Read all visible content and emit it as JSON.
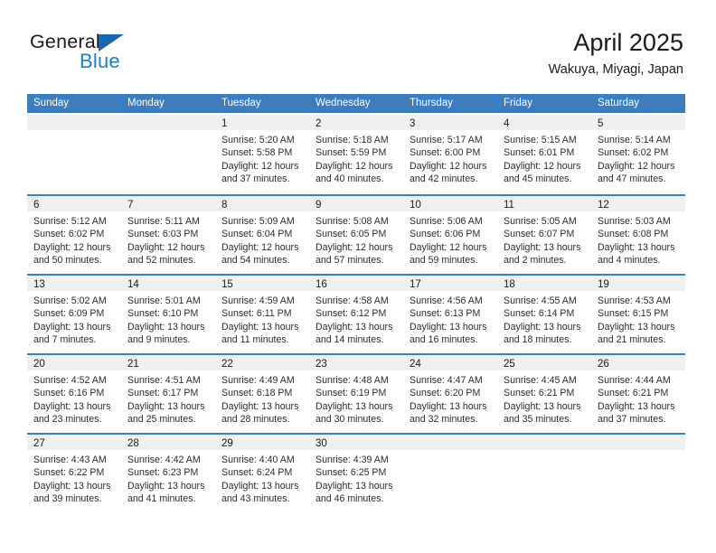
{
  "brand": {
    "name_top": "General",
    "name_bottom": "Blue",
    "triangle_icon": "brand-triangle-icon",
    "color_dark": "#1a1a1a",
    "color_blue": "#1f7fc4"
  },
  "header": {
    "title": "April 2025",
    "subtitle": "Wakuya, Miyagi, Japan"
  },
  "colors": {
    "header_blue": "#3d7cbd",
    "day_strip_gray": "#f0f0f0",
    "text": "#1a1a1a"
  },
  "weekdays": [
    "Sunday",
    "Monday",
    "Tuesday",
    "Wednesday",
    "Thursday",
    "Friday",
    "Saturday"
  ],
  "weeks": [
    [
      {
        "day": "",
        "lines": []
      },
      {
        "day": "",
        "lines": []
      },
      {
        "day": "1",
        "lines": [
          "Sunrise: 5:20 AM",
          "Sunset: 5:58 PM",
          "Daylight: 12 hours",
          "and 37 minutes."
        ]
      },
      {
        "day": "2",
        "lines": [
          "Sunrise: 5:18 AM",
          "Sunset: 5:59 PM",
          "Daylight: 12 hours",
          "and 40 minutes."
        ]
      },
      {
        "day": "3",
        "lines": [
          "Sunrise: 5:17 AM",
          "Sunset: 6:00 PM",
          "Daylight: 12 hours",
          "and 42 minutes."
        ]
      },
      {
        "day": "4",
        "lines": [
          "Sunrise: 5:15 AM",
          "Sunset: 6:01 PM",
          "Daylight: 12 hours",
          "and 45 minutes."
        ]
      },
      {
        "day": "5",
        "lines": [
          "Sunrise: 5:14 AM",
          "Sunset: 6:02 PM",
          "Daylight: 12 hours",
          "and 47 minutes."
        ]
      }
    ],
    [
      {
        "day": "6",
        "lines": [
          "Sunrise: 5:12 AM",
          "Sunset: 6:02 PM",
          "Daylight: 12 hours",
          "and 50 minutes."
        ]
      },
      {
        "day": "7",
        "lines": [
          "Sunrise: 5:11 AM",
          "Sunset: 6:03 PM",
          "Daylight: 12 hours",
          "and 52 minutes."
        ]
      },
      {
        "day": "8",
        "lines": [
          "Sunrise: 5:09 AM",
          "Sunset: 6:04 PM",
          "Daylight: 12 hours",
          "and 54 minutes."
        ]
      },
      {
        "day": "9",
        "lines": [
          "Sunrise: 5:08 AM",
          "Sunset: 6:05 PM",
          "Daylight: 12 hours",
          "and 57 minutes."
        ]
      },
      {
        "day": "10",
        "lines": [
          "Sunrise: 5:06 AM",
          "Sunset: 6:06 PM",
          "Daylight: 12 hours",
          "and 59 minutes."
        ]
      },
      {
        "day": "11",
        "lines": [
          "Sunrise: 5:05 AM",
          "Sunset: 6:07 PM",
          "Daylight: 13 hours",
          "and 2 minutes."
        ]
      },
      {
        "day": "12",
        "lines": [
          "Sunrise: 5:03 AM",
          "Sunset: 6:08 PM",
          "Daylight: 13 hours",
          "and 4 minutes."
        ]
      }
    ],
    [
      {
        "day": "13",
        "lines": [
          "Sunrise: 5:02 AM",
          "Sunset: 6:09 PM",
          "Daylight: 13 hours",
          "and 7 minutes."
        ]
      },
      {
        "day": "14",
        "lines": [
          "Sunrise: 5:01 AM",
          "Sunset: 6:10 PM",
          "Daylight: 13 hours",
          "and 9 minutes."
        ]
      },
      {
        "day": "15",
        "lines": [
          "Sunrise: 4:59 AM",
          "Sunset: 6:11 PM",
          "Daylight: 13 hours",
          "and 11 minutes."
        ]
      },
      {
        "day": "16",
        "lines": [
          "Sunrise: 4:58 AM",
          "Sunset: 6:12 PM",
          "Daylight: 13 hours",
          "and 14 minutes."
        ]
      },
      {
        "day": "17",
        "lines": [
          "Sunrise: 4:56 AM",
          "Sunset: 6:13 PM",
          "Daylight: 13 hours",
          "and 16 minutes."
        ]
      },
      {
        "day": "18",
        "lines": [
          "Sunrise: 4:55 AM",
          "Sunset: 6:14 PM",
          "Daylight: 13 hours",
          "and 18 minutes."
        ]
      },
      {
        "day": "19",
        "lines": [
          "Sunrise: 4:53 AM",
          "Sunset: 6:15 PM",
          "Daylight: 13 hours",
          "and 21 minutes."
        ]
      }
    ],
    [
      {
        "day": "20",
        "lines": [
          "Sunrise: 4:52 AM",
          "Sunset: 6:16 PM",
          "Daylight: 13 hours",
          "and 23 minutes."
        ]
      },
      {
        "day": "21",
        "lines": [
          "Sunrise: 4:51 AM",
          "Sunset: 6:17 PM",
          "Daylight: 13 hours",
          "and 25 minutes."
        ]
      },
      {
        "day": "22",
        "lines": [
          "Sunrise: 4:49 AM",
          "Sunset: 6:18 PM",
          "Daylight: 13 hours",
          "and 28 minutes."
        ]
      },
      {
        "day": "23",
        "lines": [
          "Sunrise: 4:48 AM",
          "Sunset: 6:19 PM",
          "Daylight: 13 hours",
          "and 30 minutes."
        ]
      },
      {
        "day": "24",
        "lines": [
          "Sunrise: 4:47 AM",
          "Sunset: 6:20 PM",
          "Daylight: 13 hours",
          "and 32 minutes."
        ]
      },
      {
        "day": "25",
        "lines": [
          "Sunrise: 4:45 AM",
          "Sunset: 6:21 PM",
          "Daylight: 13 hours",
          "and 35 minutes."
        ]
      },
      {
        "day": "26",
        "lines": [
          "Sunrise: 4:44 AM",
          "Sunset: 6:21 PM",
          "Daylight: 13 hours",
          "and 37 minutes."
        ]
      }
    ],
    [
      {
        "day": "27",
        "lines": [
          "Sunrise: 4:43 AM",
          "Sunset: 6:22 PM",
          "Daylight: 13 hours",
          "and 39 minutes."
        ]
      },
      {
        "day": "28",
        "lines": [
          "Sunrise: 4:42 AM",
          "Sunset: 6:23 PM",
          "Daylight: 13 hours",
          "and 41 minutes."
        ]
      },
      {
        "day": "29",
        "lines": [
          "Sunrise: 4:40 AM",
          "Sunset: 6:24 PM",
          "Daylight: 13 hours",
          "and 43 minutes."
        ]
      },
      {
        "day": "30",
        "lines": [
          "Sunrise: 4:39 AM",
          "Sunset: 6:25 PM",
          "Daylight: 13 hours",
          "and 46 minutes."
        ]
      },
      {
        "day": "",
        "lines": []
      },
      {
        "day": "",
        "lines": []
      },
      {
        "day": "",
        "lines": []
      }
    ]
  ]
}
